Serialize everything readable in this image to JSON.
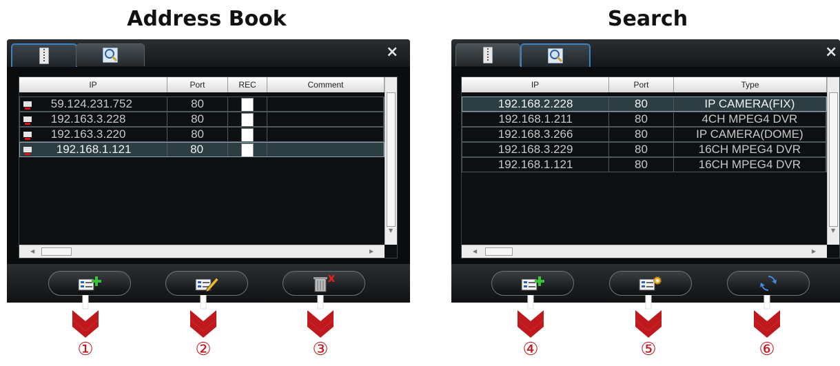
{
  "address_book": {
    "title": "Address Book",
    "close": "×",
    "columns": [
      "IP",
      "Port",
      "REC",
      "Comment"
    ],
    "rows": [
      {
        "ip": "59.124.231.752",
        "port": "80",
        "rec": false,
        "comment": ""
      },
      {
        "ip": "192.163.3.228",
        "port": "80",
        "rec": false,
        "comment": ""
      },
      {
        "ip": "192.163.3.220",
        "port": "80",
        "rec": false,
        "comment": ""
      },
      {
        "ip": "192.168.1.121",
        "port": "80",
        "rec": false,
        "comment": "",
        "selected": true
      }
    ],
    "buttons": [
      "add-address-icon",
      "edit-address-icon",
      "delete-address-icon"
    ],
    "markers": [
      "①",
      "②",
      "③"
    ]
  },
  "search": {
    "title": "Search",
    "close": "×",
    "columns": [
      "IP",
      "Port",
      "Type"
    ],
    "rows": [
      {
        "ip": "192.168.2.228",
        "port": "80",
        "type": "IP CAMERA(FIX)",
        "selected": true
      },
      {
        "ip": "192.168.1.211",
        "port": "80",
        "type": "4CH MPEG4 DVR"
      },
      {
        "ip": "192.168.3.266",
        "port": "80",
        "type": "IP CAMERA(DOME)"
      },
      {
        "ip": "192.168.3.229",
        "port": "80",
        "type": "16CH MPEG4 DVR"
      },
      {
        "ip": "192.168.1.121",
        "port": "80",
        "type": "16CH MPEG4 DVR"
      }
    ],
    "buttons": [
      "add-to-address-book-icon",
      "device-settings-icon",
      "refresh-icon"
    ],
    "markers": [
      "④",
      "⑤",
      "⑥"
    ]
  },
  "colors": {
    "accent": "#3f80c4",
    "arrow": "#c0191d",
    "panel_bg": "#0a0c0d",
    "row_selected": "#2d3e43"
  }
}
